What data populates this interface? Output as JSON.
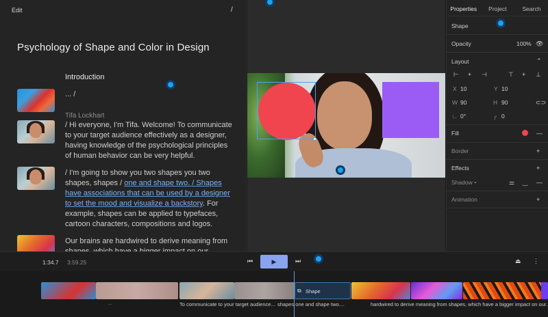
{
  "editor": {
    "edit_label": "Edit",
    "slash_label": "/",
    "title": "Psychology of Shape and Color in Design",
    "intro_heading": "Introduction",
    "ellipsis": "... /",
    "speaker": "Tifa Lockhart",
    "p1": "/ Hi everyone, I'm Tifa. Welcome! To communicate to your target audience effectively as a designer, having knowledge of the psychological principles of human behavior can be very helpful.",
    "p2_before": "/ I'm going to show you two shapes you two shapes, shapes / ",
    "p2_highlight": "one and shape two. / Shapes have associations that can be used by a designer to set the mood and visualize a backstory",
    "p2_after": ". For example, shapes can be applied to typefaces, cartoon characters, compositions and logos.",
    "p3": "Our brains are hardwired to derive meaning from shapes, which have a bigger impact on our"
  },
  "canvas": {
    "circle_color": "#f0454f",
    "square_color": "#9b5cf6"
  },
  "properties": {
    "tabs": [
      "Properties",
      "Project",
      "Search"
    ],
    "shape_label": "Shape",
    "opacity_label": "Opacity",
    "opacity_value": "100%",
    "layout_label": "Layout",
    "x_label": "X",
    "x_value": "10",
    "y_label": "Y",
    "y_value": "10",
    "w_label": "W",
    "w_value": "90",
    "h_label": "H",
    "h_value": "90",
    "angle_value": "0°",
    "radius_value": "0",
    "fill_label": "Fill",
    "fill_color": "#f0454f",
    "border_label": "Border",
    "effects_label": "Effects",
    "shadow_label": "Shadow",
    "animation_label": "Animation"
  },
  "timeline": {
    "current_time": "1:34.7",
    "total_time": "3:59.25",
    "shape_clip_label": "Shape",
    "captions": [
      "To communicate to your target audience...",
      "shapes one and shape two....",
      "hardwired to derive meaning from shapes, which have a bigger impact on our..."
    ],
    "caption_dots": "..."
  }
}
